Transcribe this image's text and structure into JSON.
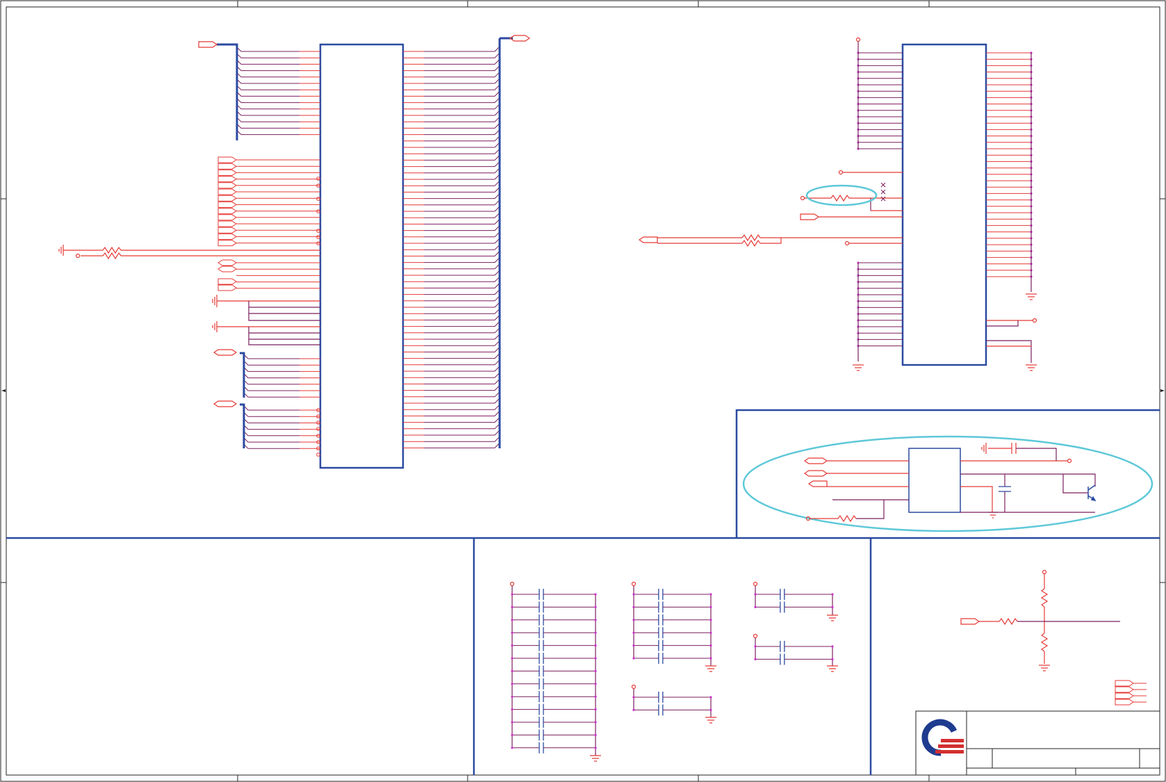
{
  "colors": {
    "wire": "#e53935",
    "bus": "#2b4aa0",
    "net": "#7a1f5c",
    "junction": "#cc33cc",
    "highlight": "#5ec8d8",
    "frame": "#222222",
    "logo_blue": "#1f3b8f",
    "logo_red": "#d32f2f"
  },
  "icons": [
    "ground-icon",
    "resistor-icon",
    "capacitor-icon",
    "transistor-icon",
    "port-icon",
    "company-logo-icon",
    "no-connect-icon"
  ],
  "sheet": {
    "zones": 5,
    "rows": 4
  }
}
